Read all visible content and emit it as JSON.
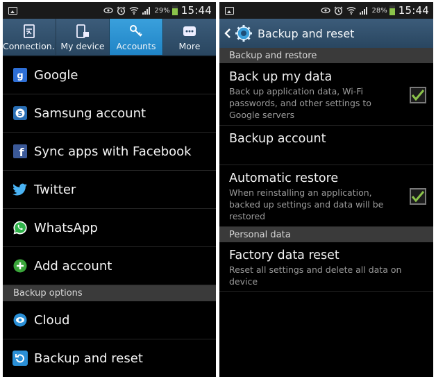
{
  "left": {
    "status": {
      "battery": "29%",
      "time": "15:44"
    },
    "tabs": [
      {
        "label": "Connection..",
        "icon": "connections-icon"
      },
      {
        "label": "My device",
        "icon": "device-icon"
      },
      {
        "label": "Accounts",
        "icon": "key-icon",
        "active": true
      },
      {
        "label": "More",
        "icon": "more-icon"
      }
    ],
    "items": [
      {
        "label": "Google",
        "icon": "google-icon"
      },
      {
        "label": "Samsung account",
        "icon": "samsung-icon"
      },
      {
        "label": "Sync apps with Facebook",
        "icon": "facebook-icon"
      },
      {
        "label": "Twitter",
        "icon": "twitter-icon"
      },
      {
        "label": "WhatsApp",
        "icon": "whatsapp-icon"
      },
      {
        "label": "Add account",
        "icon": "add-icon"
      }
    ],
    "backup_section": "Backup options",
    "backup_items": [
      {
        "label": "Cloud",
        "icon": "cloud-icon"
      },
      {
        "label": "Backup and reset",
        "icon": "backup-reset-icon"
      }
    ]
  },
  "right": {
    "status": {
      "battery": "28%",
      "time": "15:44"
    },
    "title": "Backup and reset",
    "sections": [
      {
        "header": "Backup and restore",
        "settings": [
          {
            "title": "Back up my data",
            "desc": "Back up application data, Wi-Fi passwords, and other settings to Google servers",
            "checked": true
          },
          {
            "title": "Backup account",
            "desc": "",
            "checked": null
          },
          {
            "title": "Automatic restore",
            "desc": "When reinstalling an application, backed up settings and data will be restored",
            "checked": true
          }
        ]
      },
      {
        "header": "Personal data",
        "settings": [
          {
            "title": "Factory data reset",
            "desc": "Reset all settings and delete all data on device",
            "checked": null
          }
        ]
      }
    ]
  },
  "colors": {
    "accent_tab": "#1f84c6",
    "header": "#294660",
    "check": "#8bc34a",
    "section": "#3a3a3a"
  }
}
